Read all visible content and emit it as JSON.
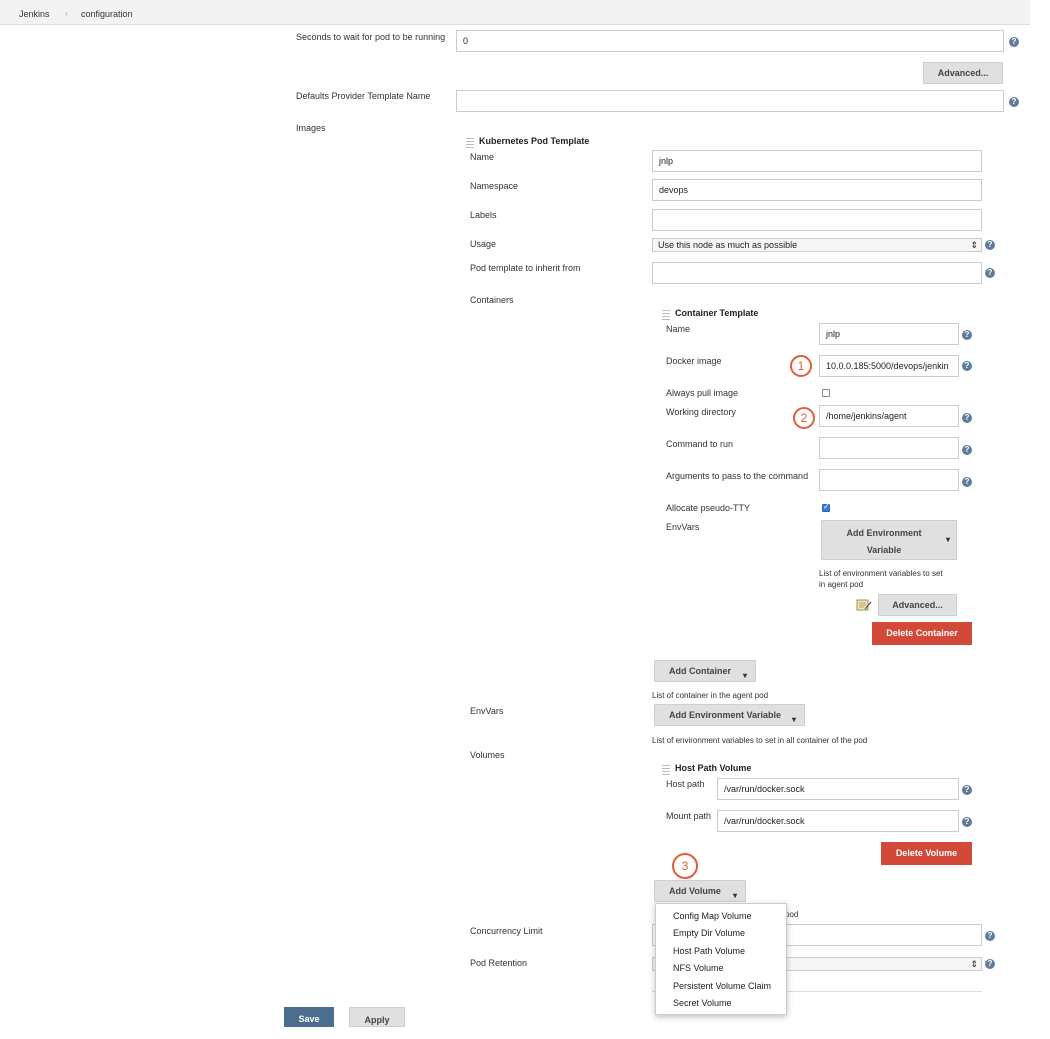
{
  "breadcrumb": [
    "Jenkins",
    "configuration"
  ],
  "breadcrumb_sep": "›",
  "top": {
    "seconds_label": "Seconds to wait for pod to be running",
    "seconds_value": "0",
    "advanced_label": "Advanced...",
    "defaults_label": "Defaults Provider Template Name",
    "defaults_value": "",
    "images_label": "Images"
  },
  "pod_template": {
    "title": "Kubernetes Pod Template",
    "name_label": "Name",
    "name_value": "jnlp",
    "namespace_label": "Namespace",
    "namespace_value": "devops",
    "labels_label": "Labels",
    "labels_value": "",
    "usage_label": "Usage",
    "usage_value": "Use this node as much as possible",
    "inherit_label": "Pod template to inherit from",
    "inherit_value": "",
    "containers_label": "Containers",
    "envvars_label": "EnvVars",
    "volumes_label": "Volumes",
    "concurrency_label": "Concurrency Limit",
    "retention_label": "Pod Retention",
    "add_container_label": "Add Container",
    "add_container_hint": "List of container in the agent pod",
    "add_env_label": "Add Environment Variable",
    "add_env_hint": "List of environment variables to set in all container of the pod",
    "add_volume_label": "Add Volume",
    "add_volume_hint_tail": "pod"
  },
  "container": {
    "title": "Container Template",
    "name_label": "Name",
    "name_value": "jnlp",
    "image_label": "Docker image",
    "image_value": "10.0.0.185:5000/devops/jenkin",
    "pull_label": "Always pull image",
    "pull_checked": false,
    "workdir_label": "Working directory",
    "workdir_value": "/home/jenkins/agent",
    "command_label": "Command to run",
    "command_value": "",
    "args_label": "Arguments to pass to the command",
    "args_value": "",
    "tty_label": "Allocate pseudo-TTY",
    "tty_checked": true,
    "envvars_label": "EnvVars",
    "add_env_line1": "Add Environment",
    "add_env_line2": "Variable",
    "env_hint_line1": "List of environment variables to set",
    "env_hint_line2": "in agent pod",
    "advanced_label": "Advanced...",
    "delete_label": "Delete Container"
  },
  "host_path_volume": {
    "title": "Host Path Volume",
    "host_label": "Host path",
    "host_value": "/var/run/docker.sock",
    "mount_label": "Mount path",
    "mount_value": "/var/run/docker.sock",
    "delete_label": "Delete Volume"
  },
  "volume_menu": [
    "Config Map Volume",
    "Empty Dir Volume",
    "Host Path Volume",
    "NFS Volume",
    "Persistent Volume Claim",
    "Secret Volume"
  ],
  "annotations": [
    "1",
    "2",
    "3"
  ],
  "footer": {
    "save_label": "Save",
    "apply_label": "Apply"
  },
  "icons": {
    "help": "question-icon",
    "caret": "caret-down-icon",
    "notepad": "notepad-icon",
    "select": "select-arrows-icon"
  },
  "colors": {
    "help": "#5f7c9c",
    "danger": "#d24939",
    "annotation": "#e45c36",
    "save": "#4b6d8e"
  }
}
